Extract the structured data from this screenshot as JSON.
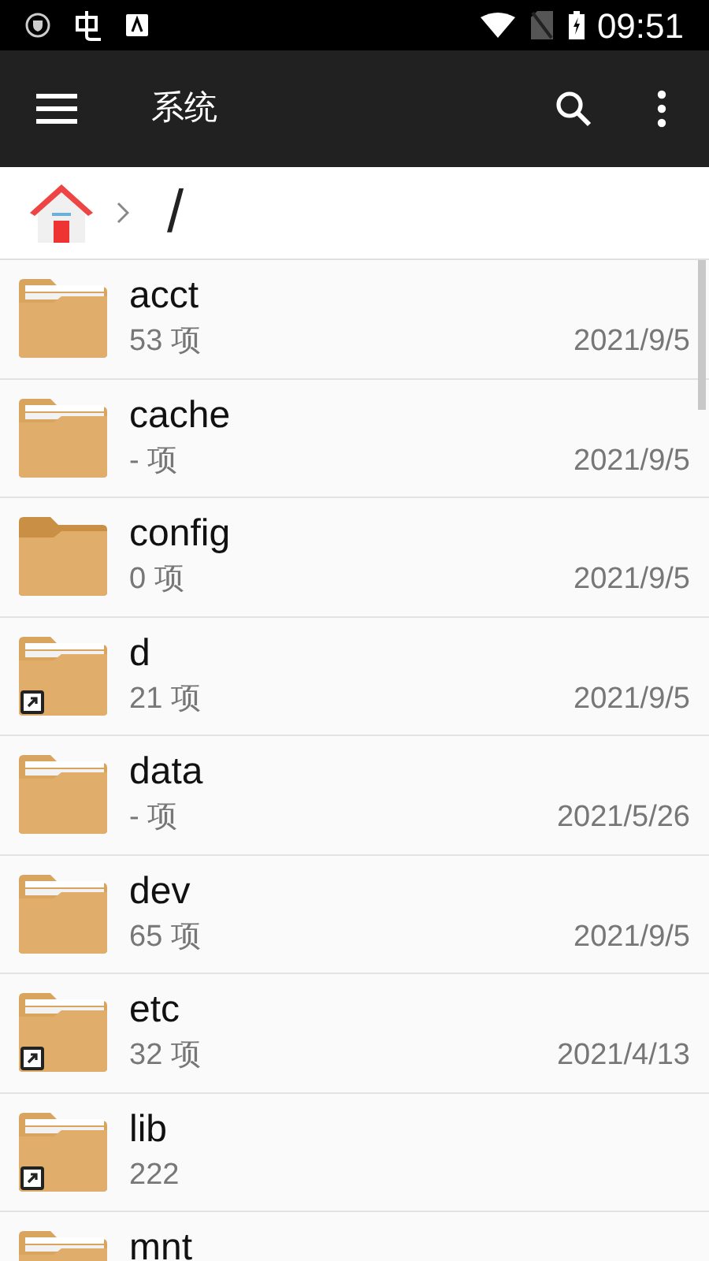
{
  "status_bar": {
    "time": "09:51"
  },
  "toolbar": {
    "title": "系统"
  },
  "breadcrumb": {
    "path": "/"
  },
  "files": [
    {
      "name": "acct",
      "count": "53 项",
      "date": "2021/9/5",
      "kind": "full",
      "shortcut": false
    },
    {
      "name": "cache",
      "count": "- 项",
      "date": "2021/9/5",
      "kind": "full",
      "shortcut": false
    },
    {
      "name": "config",
      "count": "0 项",
      "date": "2021/9/5",
      "kind": "empty",
      "shortcut": false
    },
    {
      "name": "d",
      "count": "21 项",
      "date": "2021/9/5",
      "kind": "full",
      "shortcut": true
    },
    {
      "name": "data",
      "count": "- 项",
      "date": "2021/5/26",
      "kind": "full",
      "shortcut": false
    },
    {
      "name": "dev",
      "count": "65 项",
      "date": "2021/9/5",
      "kind": "full",
      "shortcut": false
    },
    {
      "name": "etc",
      "count": "32 项",
      "date": "2021/4/13",
      "kind": "full",
      "shortcut": true
    },
    {
      "name": "lib",
      "count": "222",
      "kind": "full",
      "shortcut": true
    },
    {
      "name": "mnt",
      "kind": "full"
    }
  ]
}
